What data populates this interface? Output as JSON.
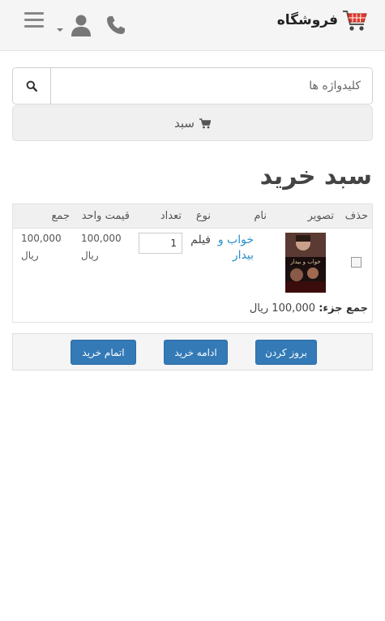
{
  "header": {
    "brand": "فروشگاه",
    "icons": [
      "shopping-cart-icon",
      "phone-icon",
      "user-icon",
      "menu-icon"
    ]
  },
  "search": {
    "placeholder": "کلیدواژه ها",
    "button_icon": "search-icon"
  },
  "cart_button": {
    "label": "سبد",
    "icon": "cart-icon"
  },
  "page": {
    "title": "سبد خرید"
  },
  "table": {
    "headers": {
      "delete": "حذف",
      "image": "تصویر",
      "name": "نام",
      "type": "نوع",
      "quantity": "تعداد",
      "unit_price": "قیمت واحد",
      "total": "جمع"
    },
    "rows": [
      {
        "name": "خواب و بیدار",
        "type": "فیلم",
        "quantity": "1",
        "unit_price": "100,000",
        "unit_price_currency": "ریال",
        "total": "100,000",
        "total_currency": "ریال",
        "poster_text": "خواب و بیدار",
        "selected": false
      }
    ],
    "subtotal_label": "جمع جزء:",
    "subtotal_value": "100,000 ریال"
  },
  "actions": {
    "update": "بروز کردن",
    "continue": "ادامه خرید",
    "checkout": "اتمام خرید"
  },
  "colors": {
    "primary_button": "#337ab7",
    "link": "#2a8fc9",
    "header_bg": "#f5f5f5"
  }
}
